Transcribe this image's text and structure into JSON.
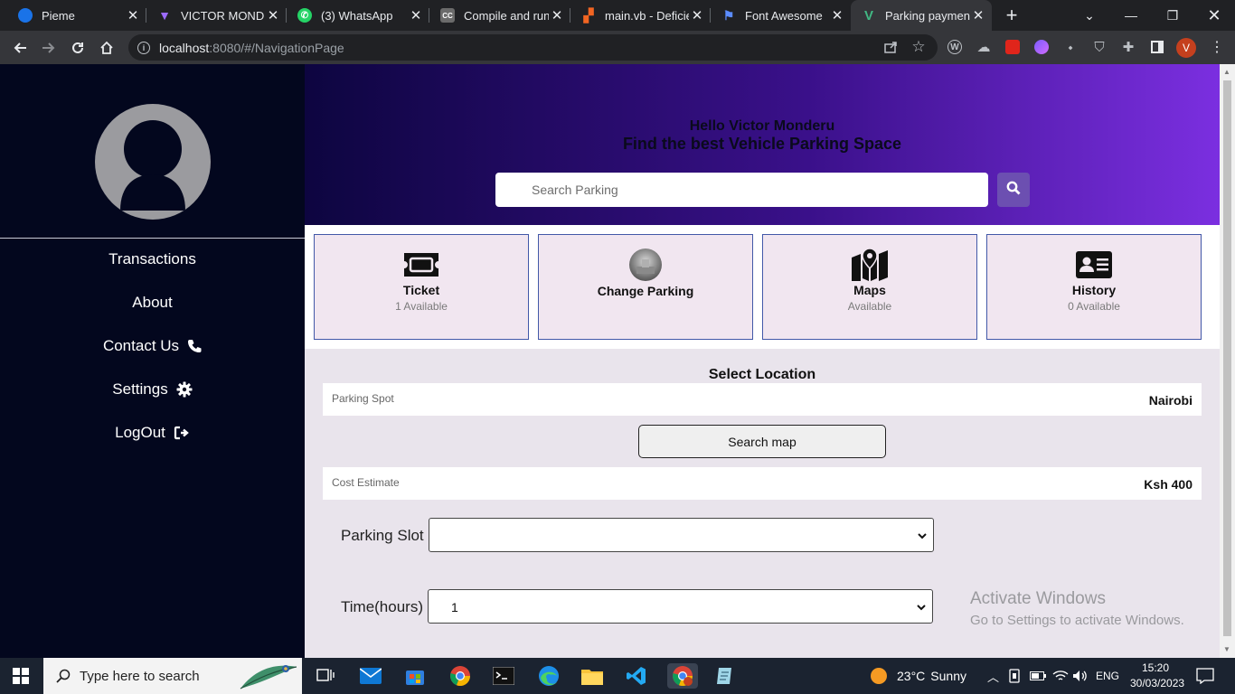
{
  "browser": {
    "tabs": [
      {
        "title": "Pieme",
        "fav_color": "#1a73e8",
        "fav_char": "◉"
      },
      {
        "title": "VICTOR MONDERU",
        "fav_color": "#7c4dff",
        "fav_char": "▼"
      },
      {
        "title": "(3) WhatsApp",
        "fav_color": "#25d366",
        "fav_char": "✆"
      },
      {
        "title": "Compile and run",
        "fav_color": "#5f5f5f",
        "fav_char": "CC"
      },
      {
        "title": "main.vb - Deficie",
        "fav_color": "#f26522",
        "fav_char": "▞"
      },
      {
        "title": "Font Awesome",
        "fav_color": "#3b5bdb",
        "fav_char": "⚑"
      },
      {
        "title": "Parking payment",
        "fav_color": "#41b883",
        "fav_char": "V"
      }
    ],
    "new_tab": "+",
    "url_host": "localhost",
    "url_rest": ":8080/#/NavigationPage",
    "profile_initial": "V"
  },
  "sidebar": {
    "items": [
      {
        "label": "Transactions",
        "icon": "none"
      },
      {
        "label": "About",
        "icon": "none"
      },
      {
        "label": "Contact Us",
        "icon": "phone-icon"
      },
      {
        "label": "Settings",
        "icon": "gear-icon"
      },
      {
        "label": "LogOut",
        "icon": "sign-out-icon"
      }
    ]
  },
  "hero": {
    "greeting": "Hello Victor Monderu",
    "headline": "Find the best Vehicle Parking Space",
    "search_placeholder": "Search Parking"
  },
  "cards": [
    {
      "title": "Ticket",
      "subtitle": "1 Available",
      "icon": "ticket-icon"
    },
    {
      "title": "Change Parking",
      "subtitle": "",
      "icon": "parking-thumbnail"
    },
    {
      "title": "Maps",
      "subtitle": "Available",
      "icon": "map-location-icon"
    },
    {
      "title": "History",
      "subtitle": "0 Available",
      "icon": "id-card-icon"
    }
  ],
  "form": {
    "section_title": "Select Location",
    "parking_spot_label": "Parking Spot",
    "parking_spot_value": "Nairobi",
    "search_map_button": "Search map",
    "cost_label": "Cost Estimate",
    "cost_value": "Ksh 400",
    "slot_label": "Parking Slot",
    "slot_value": "",
    "time_label": "Time(hours)",
    "time_value": "1"
  },
  "watermark": {
    "line1": "Activate Windows",
    "line2": "Go to Settings to activate Windows."
  },
  "taskbar": {
    "search_placeholder": "Type here to search",
    "weather_temp": "23°C",
    "weather_text": "Sunny",
    "language": "ENG",
    "time": "15:20",
    "date": "30/03/2023"
  },
  "colors": {
    "sidebar_bg": "#03071e",
    "hero_gradient_end": "#7b2fe0",
    "card_border": "#4258a8",
    "search_button": "#6c4fb1"
  }
}
